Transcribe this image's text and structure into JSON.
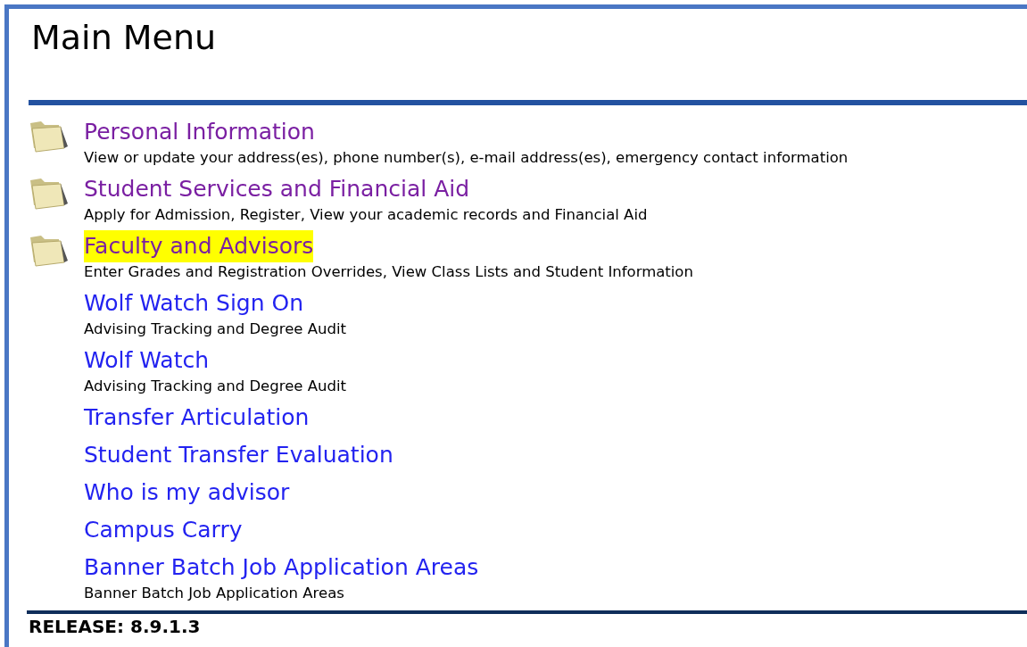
{
  "title": "Main Menu",
  "items": [
    {
      "kind": "folder",
      "label": "Personal Information",
      "visited": true,
      "highlighted": false,
      "description": "View or update your address(es), phone number(s), e-mail address(es), emergency contact information"
    },
    {
      "kind": "folder",
      "label": "Student Services and Financial Aid",
      "visited": true,
      "highlighted": false,
      "description": "Apply for Admission, Register, View your academic records and Financial Aid"
    },
    {
      "kind": "folder",
      "label": "Faculty and Advisors",
      "visited": true,
      "highlighted": true,
      "description": "Enter Grades and Registration Overrides, View Class Lists and Student Information"
    },
    {
      "kind": "link",
      "label": "Wolf Watch Sign On",
      "visited": false,
      "highlighted": false,
      "description": "Advising Tracking and Degree Audit"
    },
    {
      "kind": "link",
      "label": "Wolf Watch",
      "visited": false,
      "highlighted": false,
      "description": "Advising Tracking and Degree Audit"
    },
    {
      "kind": "link",
      "label": "Transfer Articulation",
      "visited": false,
      "highlighted": false
    },
    {
      "kind": "link",
      "label": "Student Transfer Evaluation",
      "visited": false,
      "highlighted": false
    },
    {
      "kind": "link",
      "label": "Who is my advisor",
      "visited": false,
      "highlighted": false
    },
    {
      "kind": "link",
      "label": "Campus Carry",
      "visited": false,
      "highlighted": false
    },
    {
      "kind": "link",
      "label": "Banner Batch Job Application Areas",
      "visited": false,
      "highlighted": false,
      "description": "Banner Batch Job Application Areas"
    }
  ],
  "release": "RELEASE: 8.9.1.3"
}
